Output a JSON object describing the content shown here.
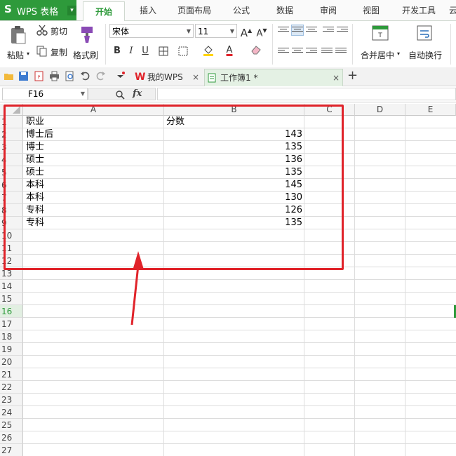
{
  "app": {
    "logo": "S",
    "name": "WPS 表格",
    "caret": "▾"
  },
  "ribbon_tabs": [
    {
      "label": "开始",
      "active": true
    },
    {
      "label": "插入"
    },
    {
      "label": "页面布局"
    },
    {
      "label": "公式"
    },
    {
      "label": "数据"
    },
    {
      "label": "审阅"
    },
    {
      "label": "视图"
    },
    {
      "label": "开发工具"
    },
    {
      "label": "云"
    }
  ],
  "ribbon": {
    "paste": "粘贴",
    "cut": "剪切",
    "copy": "复制",
    "format_painter": "格式刷",
    "font_name": "宋体",
    "font_size": "11",
    "bold": "B",
    "italic": "I",
    "underline": "U",
    "merge_center": "合并居中",
    "wrap_text": "自动换行",
    "font_color_letter": "A",
    "grow_font": "A",
    "shrink_font": "A"
  },
  "doc_tabs": [
    {
      "label": "我的WPS",
      "active": false
    },
    {
      "label": "工作簿1 *",
      "active": true
    }
  ],
  "new_tab_symbol": "+",
  "close_symbol": "×",
  "formula_bar": {
    "cell_ref": "F16",
    "fx": "fx",
    "value": ""
  },
  "columns": [
    "A",
    "B",
    "C",
    "D",
    "E"
  ],
  "rows": [
    {
      "n": "1",
      "a": "职业",
      "b": "分数"
    },
    {
      "n": "2",
      "a": "博士后",
      "b": "143"
    },
    {
      "n": "3",
      "a": "博士",
      "b": "135"
    },
    {
      "n": "4",
      "a": "硕士",
      "b": "136"
    },
    {
      "n": "5",
      "a": "硕士",
      "b": "135"
    },
    {
      "n": "6",
      "a": "本科",
      "b": "145"
    },
    {
      "n": "7",
      "a": "本科",
      "b": "130"
    },
    {
      "n": "8",
      "a": "专科",
      "b": "126"
    },
    {
      "n": "9",
      "a": "专科",
      "b": "135"
    },
    {
      "n": "10",
      "a": "",
      "b": ""
    },
    {
      "n": "11",
      "a": "",
      "b": ""
    },
    {
      "n": "12",
      "a": "",
      "b": ""
    },
    {
      "n": "13",
      "a": "",
      "b": ""
    },
    {
      "n": "14",
      "a": "",
      "b": ""
    },
    {
      "n": "15",
      "a": "",
      "b": ""
    },
    {
      "n": "16",
      "a": "",
      "b": ""
    },
    {
      "n": "17",
      "a": "",
      "b": ""
    },
    {
      "n": "18",
      "a": "",
      "b": ""
    },
    {
      "n": "19",
      "a": "",
      "b": ""
    },
    {
      "n": "20",
      "a": "",
      "b": ""
    },
    {
      "n": "21",
      "a": "",
      "b": ""
    },
    {
      "n": "22",
      "a": "",
      "b": ""
    },
    {
      "n": "23",
      "a": "",
      "b": ""
    },
    {
      "n": "24",
      "a": "",
      "b": ""
    },
    {
      "n": "25",
      "a": "",
      "b": ""
    },
    {
      "n": "26",
      "a": "",
      "b": ""
    },
    {
      "n": "27",
      "a": "",
      "b": ""
    }
  ],
  "selected_row": "16",
  "colors": {
    "accent": "#2e9a3b",
    "annotation": "#e0232a"
  }
}
